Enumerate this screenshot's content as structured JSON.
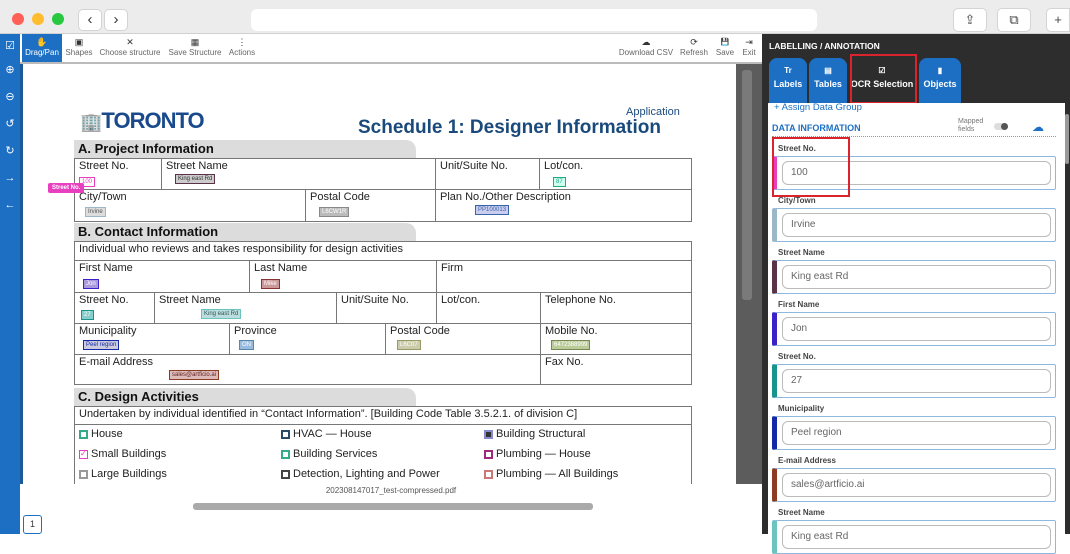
{
  "browser": {
    "back": "‹",
    "forward": "›",
    "share_icon": "share-icon",
    "tabs_icon": "tabs-icon",
    "new_tab": "+"
  },
  "left_sidebar": [
    "☑",
    "⊕",
    "⊖",
    "↺",
    "↻",
    "→",
    "←"
  ],
  "toolbar": {
    "items": [
      {
        "icon": "✋",
        "label": "Drag/Pan"
      },
      {
        "icon": "▣",
        "label": "Shapes"
      },
      {
        "icon": "✕",
        "label": "Choose structure"
      },
      {
        "icon": "▦",
        "label": "Save Structure"
      },
      {
        "icon": "⋮",
        "label": "Actions"
      }
    ],
    "right_items": [
      {
        "icon": "☁",
        "label": "Download CSV"
      },
      {
        "icon": "⟳",
        "label": "Refresh"
      },
      {
        "icon": "💾",
        "label": "Save"
      },
      {
        "icon": "⇥",
        "label": "Exit"
      }
    ]
  },
  "document": {
    "filename": "202308147017_test-compressed.pdf",
    "page": "1",
    "logo": "TORONTO",
    "app_label": "Application",
    "title": "Schedule 1: Designer Information",
    "overlay_label": "Street No.",
    "sectionA": {
      "title": "A. Project Information",
      "street_no": "Street No.",
      "street_name": "Street Name",
      "unit": "Unit/Suite No.",
      "lot": "Lot/con.",
      "city": "City/Town",
      "postal": "Postal Code",
      "plan": "Plan No./Other Description",
      "v_street_no": "100",
      "v_street_name": "King east Rd",
      "v_lot": "87",
      "v_city": "Irvine",
      "v_postal": "L6CW1R",
      "v_plan": "PP100013"
    },
    "sectionB": {
      "title": "B. Contact Information",
      "intro": "Individual who reviews and takes responsibility for design activities",
      "first": "First Name",
      "last": "Last Name",
      "firm": "Firm",
      "street_no": "Street No.",
      "street_name": "Street Name",
      "unit": "Unit/Suite No.",
      "lot": "Lot/con.",
      "tel": "Telephone No.",
      "muni": "Municipality",
      "prov": "Province",
      "postal": "Postal Code",
      "mobile": "Mobile No.",
      "email": "E-mail Address",
      "fax": "Fax No.",
      "v_first": "Jon",
      "v_last": "Mike",
      "v_street_no": "27",
      "v_street_name": "King east Rd",
      "v_muni": "Peel region",
      "v_prov": "ON",
      "v_postal": "L6C07",
      "v_mobile": "6472388999",
      "v_email": "sales@artficio.ai"
    },
    "sectionC": {
      "title": "C. Design Activities",
      "intro": "Undertaken by individual identified in “Contact Information”. [Building Code Table 3.5.2.1. of division C]",
      "items": [
        "House",
        "HVAC — House",
        "Building Structural",
        "Small Buildings",
        "Building Services",
        "Plumbing — House",
        "Large Buildings",
        "Detection, Lighting and Power",
        "Plumbing — All Buildings"
      ]
    }
  },
  "panel": {
    "header": "LABELLING / ANNOTATION",
    "tabs": [
      {
        "icon": "Tr",
        "label": "Labels"
      },
      {
        "icon": "▤",
        "label": "Tables"
      },
      {
        "icon": "☑",
        "label": "OCR Selection"
      },
      {
        "icon": "▮",
        "label": "Objects"
      }
    ],
    "assign": "+ Assign Data Group",
    "data_info": "DATA INFORMATION",
    "mapped": "Mapped fields",
    "fields": [
      {
        "label": "Street No.",
        "value": "100",
        "color": "#e83fbf"
      },
      {
        "label": "City/Town",
        "value": "Irvine",
        "color": "#9ab8c8"
      },
      {
        "label": "Street Name",
        "value": "King east Rd",
        "color": "#5a3348"
      },
      {
        "label": "First Name",
        "value": "Jon",
        "color": "#3a22c8"
      },
      {
        "label": "Street No.",
        "value": "27",
        "color": "#17948c"
      },
      {
        "label": "Municipality",
        "value": "Peel region",
        "color": "#1428a8"
      },
      {
        "label": "E-mail Address",
        "value": "sales@artficio.ai",
        "color": "#8c3c22"
      },
      {
        "label": "Street Name",
        "value": "King east Rd",
        "color": "#6cc4c0"
      }
    ]
  }
}
